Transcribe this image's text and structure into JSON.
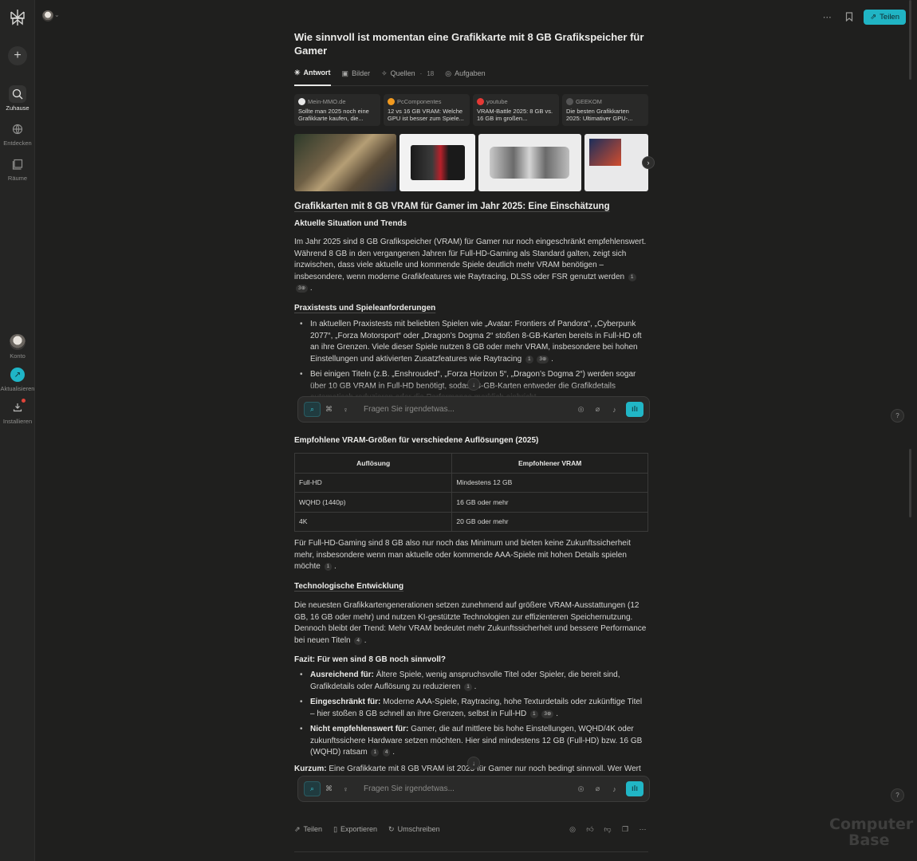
{
  "sidebar": {
    "new_label": "+",
    "items": [
      {
        "label": "Zuhause",
        "icon": "search-icon"
      },
      {
        "label": "Entdecken",
        "icon": "globe-icon"
      },
      {
        "label": "Räume",
        "icon": "spaces-icon"
      }
    ],
    "account_label": "Konto",
    "update_label": "Aktualisieren",
    "install_label": "Installieren"
  },
  "topbar": {
    "share_label": "Teilen"
  },
  "thread": {
    "title": "Wie sinnvoll ist momentan eine Grafikkarte mit 8 GB Grafikspeicher für Gamer",
    "tabs": [
      {
        "label": "Antwort"
      },
      {
        "label": "Bilder"
      },
      {
        "label": "Quellen",
        "sep": "·",
        "count": "18"
      },
      {
        "label": "Aufgaben"
      }
    ]
  },
  "sources": [
    {
      "site": "Mein-MMO.de",
      "title": "Sollte man 2025 noch eine Grafikkarte kaufen, die...",
      "color": "#e8e8e8"
    },
    {
      "site": "PcComponentes",
      "title": "12 vs 16 GB VRAM: Welche GPU ist besser zum Spiele...",
      "color": "#f29a1f"
    },
    {
      "site": "youtube",
      "title": "VRAM-Battle 2025: 8 GB vs. 16 GB im großen...",
      "color": "#e53935"
    },
    {
      "site": "GEEKOM",
      "title": "Die besten Grafikkarten 2025: Ultimativer GPU-...",
      "color": "#555555"
    }
  ],
  "answer": {
    "h_main": "Grafikkarten mit 8 GB VRAM für Gamer im Jahr 2025: Eine Einschätzung",
    "h_situation": "Aktuelle Situation und Trends",
    "p1": "Im Jahr 2025 sind 8 GB Grafikspeicher (VRAM) für Gamer nur noch eingeschränkt empfehlenswert. Während 8 GB in den vergangenen Jahren für Full-HD-Gaming als Standard galten, zeigt sich inzwischen, dass viele aktuelle und kommende Spiele deutlich mehr VRAM benötigen – insbesondere, wenn moderne Grafikfeatures wie Raytracing, DLSS oder FSR genutzt werden",
    "p1_cites": [
      "1",
      "3⊕"
    ],
    "h_praxis": "Praxistests und Spieleanforderungen",
    "b1": "In aktuellen Praxistests mit beliebten Spielen wie „Avatar: Frontiers of Pandora“, „Cyberpunk 2077“, „Forza Motorsport“ oder „Dragon’s Dogma 2“ stoßen 8-GB-Karten bereits in Full-HD oft an ihre Grenzen. Viele dieser Spiele nutzen 8 GB oder mehr VRAM, insbesondere bei hohen Einstellungen und aktivierten Zusatzfeatures wie Raytracing",
    "b1_cites": [
      "1",
      "3⊕"
    ],
    "b2": "Bei einigen Titeln (z.B. „Enshrouded“, „Forza Horizon 5“, „Dragon’s Dogma 2“) werden sogar über 10 GB VRAM in Full-HD benötigt, sodass 8-GB-Karten entweder die Grafikdetails automatisch reduzieren oder die Performance merklich einbricht",
    "h_vram": "Empfohlene VRAM-Größen für verschiedene Auflösungen (2025)",
    "table": {
      "headers": [
        "Auflösung",
        "Empfohlener VRAM"
      ],
      "rows": [
        [
          "Full-HD",
          "Mindestens 12 GB"
        ],
        [
          "WQHD (1440p)",
          "16 GB oder mehr"
        ],
        [
          "4K",
          "20 GB oder mehr"
        ]
      ]
    },
    "p2": "Für Full-HD-Gaming sind 8 GB also nur noch das Minimum und bieten keine Zukunftssicherheit mehr, insbesondere wenn man aktuelle oder kommende AAA-Spiele mit hohen Details spielen möchte",
    "p2_cite": "1",
    "h_tech": "Technologische Entwicklung",
    "p3": "Die neuesten Grafikkartengenerationen setzen zunehmend auf größere VRAM-Ausstattungen (12 GB, 16 GB oder mehr) und nutzen KI-gestützte Technologien zur effizienteren Speichernutzung. Dennoch bleibt der Trend: Mehr VRAM bedeutet mehr Zukunftssicherheit und bessere Performance bei neuen Titeln",
    "p3_cite": "4",
    "h_fazit": "Fazit: Für wen sind 8 GB noch sinnvoll?",
    "f1_bold": "Ausreichend für:",
    "f1": " Ältere Spiele, wenig anspruchsvolle Titel oder Spieler, die bereit sind, Grafikdetails oder Auflösung zu reduzieren",
    "f1_cite": "1",
    "f2_bold": "Eingeschränkt für:",
    "f2": " Moderne AAA-Spiele, Raytracing, hohe Texturdetails oder zukünftige Titel – hier stoßen 8 GB schnell an ihre Grenzen, selbst in Full-HD",
    "f2_cites": [
      "1",
      "3⊕"
    ],
    "f3_bold": "Nicht empfehlenswert für:",
    "f3": " Gamer, die auf mittlere bis hohe Einstellungen, WQHD/4K oder zukunftssichere Hardware setzen möchten. Hier sind mindestens 12 GB (Full-HD) bzw. 16 GB (WQHD) ratsam",
    "f3_cites": [
      "1",
      "4"
    ],
    "k_bold": "Kurzum:",
    "k": " Eine Grafikkarte mit 8 GB VRAM ist 2025 für Gamer nur noch bedingt sinnvoll. Wer Wert"
  },
  "ask": {
    "placeholder": "Fragen Sie irgendetwas..."
  },
  "actions": {
    "share": "Teilen",
    "export": "Exportieren",
    "rewrite": "Umschreiben"
  },
  "help_label": "?",
  "watermark": {
    "line1": "Computer",
    "line2": "Base"
  },
  "colors": {
    "accent": "#20b4c4",
    "background": "#1f1f1e"
  }
}
